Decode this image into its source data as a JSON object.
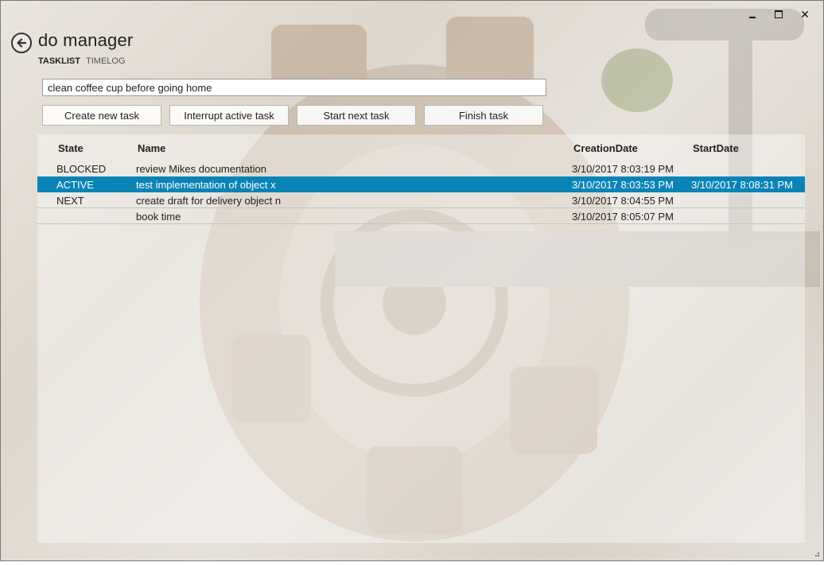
{
  "window": {
    "controls": {
      "minimize_icon": "minimize-icon",
      "maximize_icon": "maximize-icon",
      "close_label": "✕"
    }
  },
  "header": {
    "title": "do manager",
    "back_icon": "back-arrow-icon",
    "tabs": [
      {
        "label": "TASKLIST",
        "selected": true
      },
      {
        "label": "TIMELOG",
        "selected": false
      }
    ]
  },
  "input": {
    "value": "clean coffee cup before going home"
  },
  "actions": {
    "create_label": "Create new task",
    "interrupt_label": "Interrupt active task",
    "start_label": "Start next task",
    "finish_label": "Finish task"
  },
  "table": {
    "columns": [
      "State",
      "Name",
      "CreationDate",
      "StartDate"
    ],
    "rows": [
      {
        "state": "BLOCKED",
        "name": "review Mikes documentation",
        "created": "3/10/2017 8:03:19 PM",
        "start": "",
        "selected": false
      },
      {
        "state": "ACTIVE",
        "name": "test implementation of object x",
        "created": "3/10/2017 8:03:53 PM",
        "start": "3/10/2017 8:08:31 PM",
        "selected": true
      },
      {
        "state": "NEXT",
        "name": "create draft for delivery object n",
        "created": "3/10/2017 8:04:55 PM",
        "start": "",
        "selected": false
      },
      {
        "state": "",
        "name": "book time",
        "created": "3/10/2017 8:05:07 PM",
        "start": "",
        "selected": false
      }
    ]
  },
  "colors": {
    "selection": "#0a84b6",
    "text": "#222222"
  }
}
